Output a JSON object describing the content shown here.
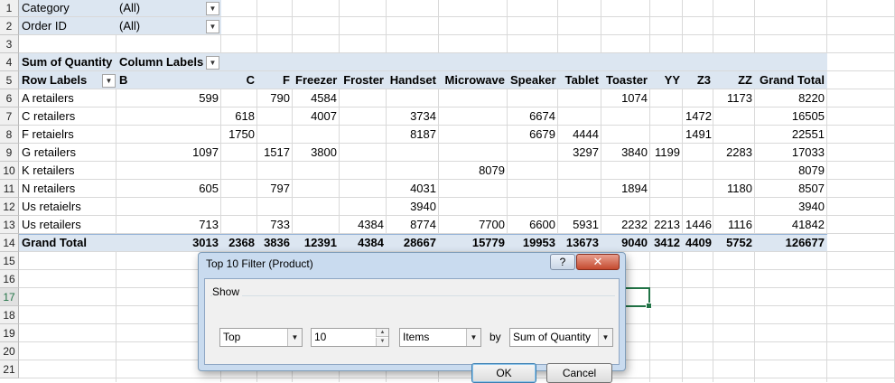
{
  "row_numbers": [
    "1",
    "2",
    "3",
    "4",
    "5",
    "6",
    "7",
    "8",
    "9",
    "10",
    "11",
    "12",
    "13",
    "14",
    "15",
    "16",
    "17",
    "18",
    "19",
    "20",
    "21"
  ],
  "filters": [
    {
      "label": "Category",
      "value": "(All)"
    },
    {
      "label": "Order ID",
      "value": "(All)"
    }
  ],
  "pivot": {
    "values_label": "Sum of Quantity",
    "column_labels": "Column Labels",
    "row_labels": "Row Labels",
    "columns": [
      "B",
      "C",
      "F",
      "Freezer",
      "Froster",
      "Handset",
      "Microwave",
      "Speaker",
      "Tablet",
      "Toaster",
      "YY",
      "Z3",
      "ZZ",
      "Grand Total"
    ],
    "rows": [
      {
        "label": "A retailers",
        "values": [
          "599",
          "",
          "790",
          "4584",
          "",
          "",
          "",
          "",
          "",
          "1074",
          "",
          "",
          "1173",
          "8220"
        ]
      },
      {
        "label": "C retailers",
        "values": [
          "",
          "618",
          "",
          "4007",
          "",
          "3734",
          "",
          "6674",
          "",
          "",
          "",
          "1472",
          "",
          "16505"
        ]
      },
      {
        "label": "F retaielrs",
        "values": [
          "",
          "1750",
          "",
          "",
          "",
          "8187",
          "",
          "6679",
          "4444",
          "",
          "",
          "1491",
          "",
          "22551"
        ]
      },
      {
        "label": "G retailers",
        "values": [
          "1097",
          "",
          "1517",
          "3800",
          "",
          "",
          "",
          "",
          "3297",
          "3840",
          "1199",
          "",
          "2283",
          "17033"
        ]
      },
      {
        "label": "K  retailers",
        "values": [
          "",
          "",
          "",
          "",
          "",
          "",
          "8079",
          "",
          "",
          "",
          "",
          "",
          "",
          "8079"
        ]
      },
      {
        "label": "N retailers",
        "values": [
          "605",
          "",
          "797",
          "",
          "",
          "4031",
          "",
          "",
          "",
          "1894",
          "",
          "",
          "1180",
          "8507"
        ]
      },
      {
        "label": "Us retaielrs",
        "values": [
          "",
          "",
          "",
          "",
          "",
          "3940",
          "",
          "",
          "",
          "",
          "",
          "",
          "",
          "3940"
        ]
      },
      {
        "label": "Us retailers",
        "values": [
          "713",
          "",
          "733",
          "",
          "4384",
          "8774",
          "7700",
          "6600",
          "5931",
          "2232",
          "2213",
          "1446",
          "1116",
          "41842"
        ]
      }
    ],
    "grand_total": {
      "label": "Grand Total",
      "values": [
        "3013",
        "2368",
        "3836",
        "12391",
        "4384",
        "28667",
        "15779",
        "19953",
        "13673",
        "9040",
        "3412",
        "4409",
        "5752",
        "126677"
      ]
    }
  },
  "dialog": {
    "title": "Top 10 Filter (Product)",
    "help_label": "?",
    "close_label": "✕",
    "group_label": "Show",
    "direction_value": "Top",
    "count_value": "10",
    "type_value": "Items",
    "by_label": "by",
    "field_value": "Sum of Quantity",
    "ok_label": "OK",
    "cancel_label": "Cancel"
  }
}
